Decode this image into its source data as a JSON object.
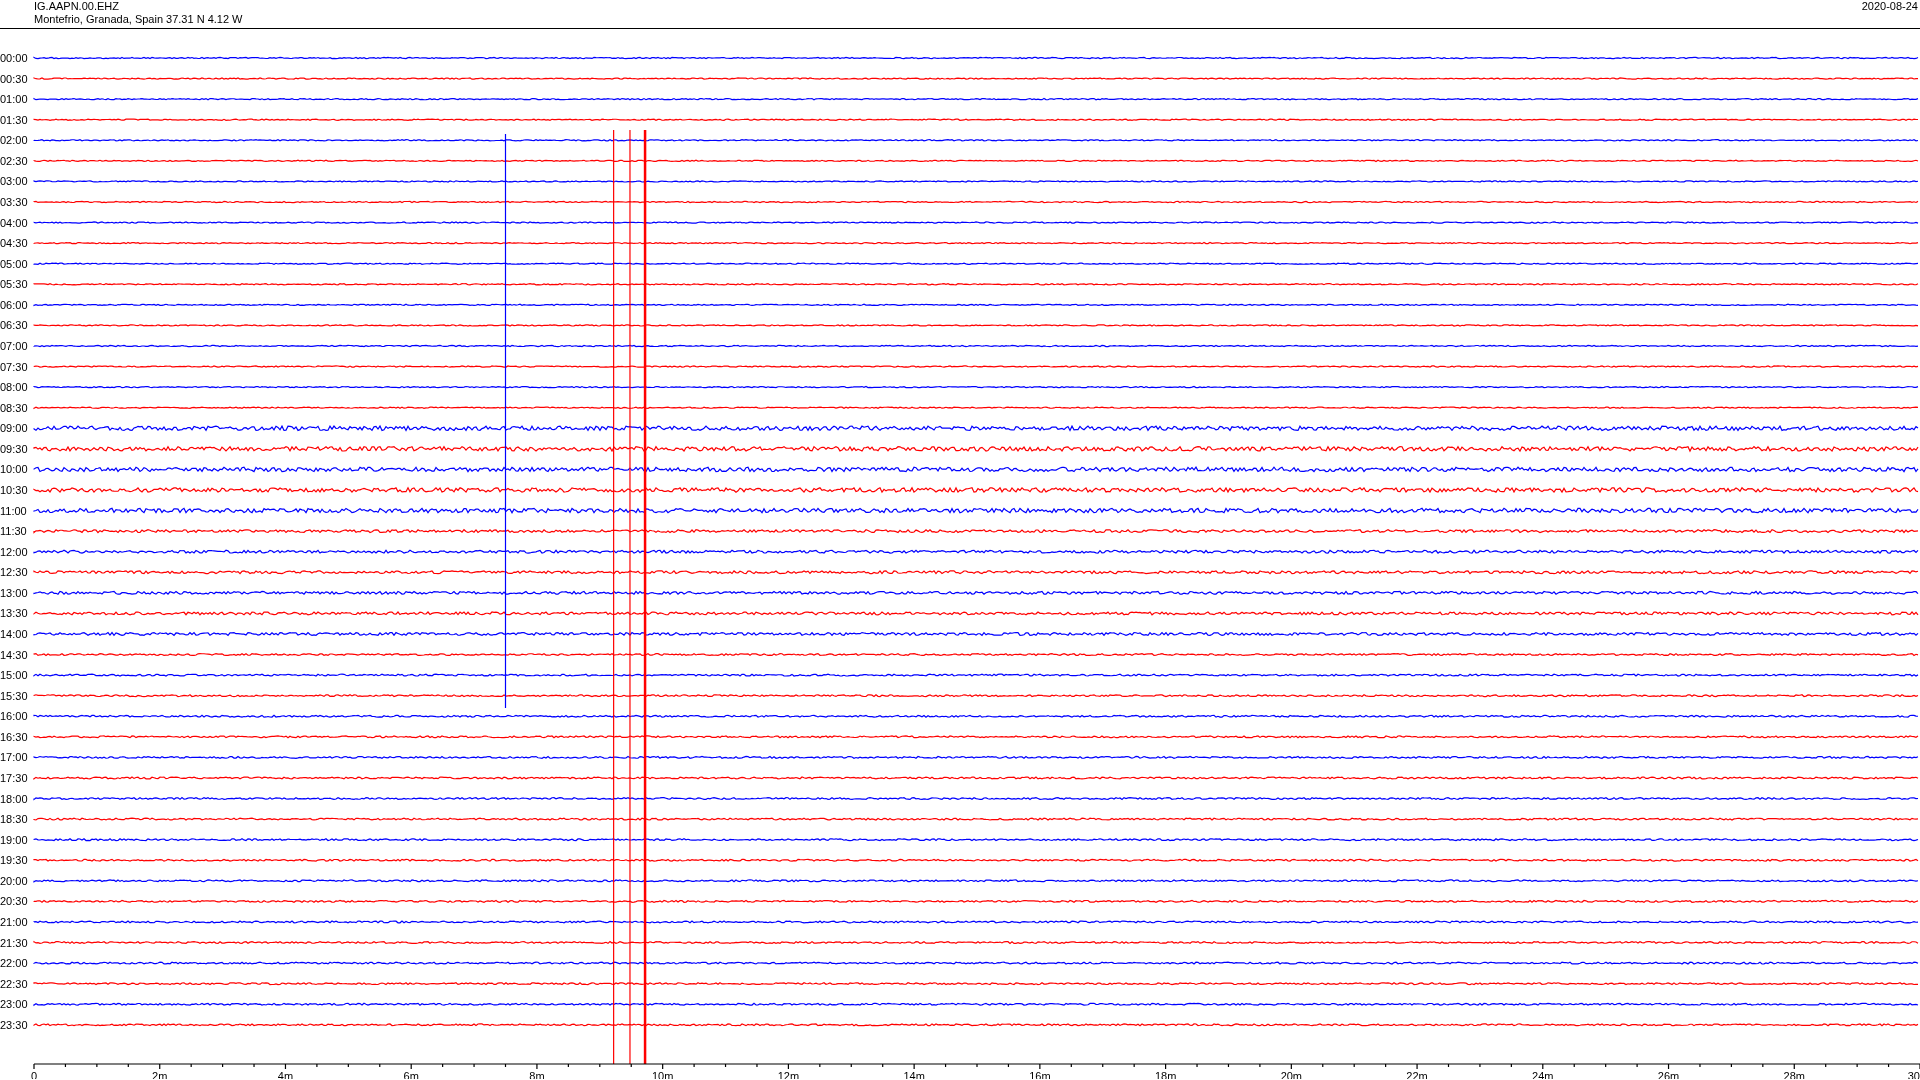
{
  "header": {
    "station": "IG.AAPN.00.EHZ",
    "location": "Montefrio, Granada, Spain  37.31 N 4.12 W",
    "date": "2020-08-24"
  },
  "rows": [
    {
      "label": "00:00",
      "color": "#0000ff"
    },
    {
      "label": "00:30",
      "color": "#ff0000"
    },
    {
      "label": "01:00",
      "color": "#0000ff"
    },
    {
      "label": "01:30",
      "color": "#ff0000"
    },
    {
      "label": "02:00",
      "color": "#0000ff"
    },
    {
      "label": "02:30",
      "color": "#ff0000"
    },
    {
      "label": "03:00",
      "color": "#0000ff"
    },
    {
      "label": "03:30",
      "color": "#ff0000"
    },
    {
      "label": "04:00",
      "color": "#0000ff"
    },
    {
      "label": "04:30",
      "color": "#ff0000"
    },
    {
      "label": "05:00",
      "color": "#0000ff"
    },
    {
      "label": "05:30",
      "color": "#ff0000"
    },
    {
      "label": "06:00",
      "color": "#0000ff"
    },
    {
      "label": "06:30",
      "color": "#ff0000"
    },
    {
      "label": "07:00",
      "color": "#0000ff"
    },
    {
      "label": "07:30",
      "color": "#ff0000"
    },
    {
      "label": "08:00",
      "color": "#0000ff"
    },
    {
      "label": "08:30",
      "color": "#ff0000"
    },
    {
      "label": "09:00",
      "color": "#0000ff"
    },
    {
      "label": "09:30",
      "color": "#ff0000"
    },
    {
      "label": "10:00",
      "color": "#0000ff"
    },
    {
      "label": "10:30",
      "color": "#ff0000"
    },
    {
      "label": "11:00",
      "color": "#0000ff"
    },
    {
      "label": "11:30",
      "color": "#ff0000"
    },
    {
      "label": "12:00",
      "color": "#0000ff"
    },
    {
      "label": "12:30",
      "color": "#ff0000"
    },
    {
      "label": "13:00",
      "color": "#0000ff"
    },
    {
      "label": "13:30",
      "color": "#ff0000"
    },
    {
      "label": "14:00",
      "color": "#0000ff"
    },
    {
      "label": "14:30",
      "color": "#ff0000"
    },
    {
      "label": "15:00",
      "color": "#0000ff"
    },
    {
      "label": "15:30",
      "color": "#ff0000"
    },
    {
      "label": "16:00",
      "color": "#0000ff"
    },
    {
      "label": "16:30",
      "color": "#ff0000"
    },
    {
      "label": "17:00",
      "color": "#0000ff"
    },
    {
      "label": "17:30",
      "color": "#ff0000"
    },
    {
      "label": "18:00",
      "color": "#0000ff"
    },
    {
      "label": "18:30",
      "color": "#ff0000"
    },
    {
      "label": "19:00",
      "color": "#0000ff"
    },
    {
      "label": "19:30",
      "color": "#ff0000"
    },
    {
      "label": "20:00",
      "color": "#0000ff"
    },
    {
      "label": "20:30",
      "color": "#ff0000"
    },
    {
      "label": "21:00",
      "color": "#0000ff"
    },
    {
      "label": "21:30",
      "color": "#ff0000"
    },
    {
      "label": "22:00",
      "color": "#0000ff"
    },
    {
      "label": "22:30",
      "color": "#ff0000"
    },
    {
      "label": "23:00",
      "color": "#0000ff"
    },
    {
      "label": "23:30",
      "color": "#ff0000"
    }
  ],
  "axis": {
    "labels": [
      "0",
      "2m",
      "4m",
      "6m",
      "8m",
      "10m",
      "12m",
      "14m",
      "16m",
      "18m",
      "20m",
      "22m",
      "24m",
      "26m",
      "28m",
      "30"
    ]
  }
}
